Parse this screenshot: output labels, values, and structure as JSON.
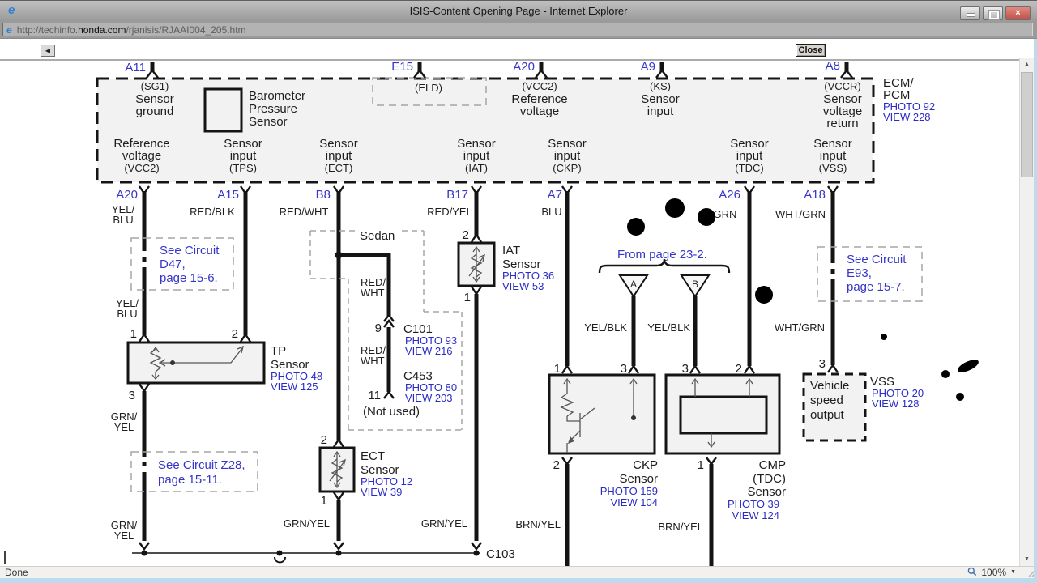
{
  "colors": {
    "link_blue": "#2b2bc6",
    "label_blue": "#3636c8",
    "diagram_black": "#1e1e1e",
    "box_fill": "#f2f2f2",
    "close_button_red": "#c0504a",
    "titlebar_gray": "#a8a8a8",
    "frame_blue": "#badcee"
  },
  "window": {
    "title": "ISIS-Content Opening Page - Internet Explorer"
  },
  "icons": {
    "ie_logo": "e",
    "back": "◀",
    "scroll_up": "▲",
    "scroll_down": "▼",
    "dropdown": "▼",
    "close_window": "×"
  },
  "address": {
    "url_pre": "http://techinfo.",
    "url_domain": "honda.com",
    "url_path": "/rjanisis/RJAAI004_205.htm"
  },
  "toolbar": {
    "close_label": "Close"
  },
  "statusbar": {
    "status": "Done",
    "zoom": "100%"
  },
  "diagram": {
    "ecm": {
      "pin_a11": "A11",
      "pin_e15": "E15",
      "pin_a20": "A20",
      "pin_a9": "A9",
      "pin_a8": "A8",
      "sg1": [
        "(SG1)",
        "Sensor",
        "ground"
      ],
      "baro": [
        "Barometer",
        "Pressure",
        "Sensor"
      ],
      "eld": "(ELD)",
      "vcc2": [
        "(VCC2)",
        "Reference",
        "voltage"
      ],
      "ks": [
        "(KS)",
        "Sensor",
        "input"
      ],
      "vccr": [
        "(VCCR)",
        "Sensor",
        "voltage",
        "return"
      ],
      "name": [
        "ECM/",
        "PCM"
      ],
      "photo": "PHOTO 92",
      "view": "VIEW 228",
      "out_vcc2": [
        "Reference",
        "voltage",
        "(VCC2)"
      ],
      "out_tps": [
        "Sensor",
        "input",
        "(TPS)"
      ],
      "out_ect": [
        "Sensor",
        "input",
        "(ECT)"
      ],
      "out_iat": [
        "Sensor",
        "input",
        "(IAT)"
      ],
      "out_ckp": [
        "Sensor",
        "input",
        "(CKP)"
      ],
      "out_tdc": [
        "Sensor",
        "input",
        "(TDC)"
      ],
      "out_vss": [
        "Sensor",
        "input",
        "(VSS)"
      ]
    },
    "pins": {
      "a20": "A20",
      "a15": "A15",
      "b8": "B8",
      "b17": "B17",
      "a7": "A7",
      "a26": "A26",
      "a18": "A18"
    },
    "wire_colors": {
      "yel_blu": [
        "YEL/",
        "BLU"
      ],
      "red_blk": "RED/BLK",
      "red_wht": "RED/WHT",
      "red_yel": "RED/YEL",
      "blu": "BLU",
      "grn": "GRN",
      "wht_grn": "WHT/GRN",
      "yel_blu_2": [
        "YEL/",
        "BLU"
      ],
      "grn_yel_1": [
        "GRN/",
        "YEL"
      ],
      "grn_yel_2": [
        "GRN/",
        "YEL"
      ],
      "red_wht_sedan_1": [
        "RED/",
        "WHT"
      ],
      "red_wht_sedan_2": [
        "RED/",
        "WHT"
      ],
      "grn_yel_ect": "GRN/YEL",
      "grn_yel_iat": "GRN/YEL",
      "yel_blk_a": "YEL/BLK",
      "yel_blk_b": "YEL/BLK",
      "brn_yel_ckp": "BRN/YEL",
      "brn_yel_cmp": "BRN/YEL",
      "wht_grn_2": "WHT/GRN"
    },
    "refs": {
      "d47": [
        "See Circuit",
        "D47,",
        "page 15-6."
      ],
      "z28": [
        "See Circuit Z28,",
        "page 15-11."
      ],
      "e93": [
        "See Circuit",
        "E93,",
        "page 15-7."
      ],
      "from_page": "From page 23-2."
    },
    "sedan_label": "Sedan",
    "not_used": "(Not used)",
    "tp": {
      "pin1": "1",
      "pin2": "2",
      "pin3": "3",
      "name": [
        "TP",
        "Sensor"
      ],
      "photo": "PHOTO 48",
      "view": "VIEW 125"
    },
    "iat": {
      "pin2": "2",
      "pin1": "1",
      "name": [
        "IAT",
        "Sensor"
      ],
      "photo": "PHOTO 36",
      "view": "VIEW 53"
    },
    "ect": {
      "pin2": "2",
      "pin1": "1",
      "name": [
        "ECT",
        "Sensor"
      ],
      "photo": "PHOTO 12",
      "view": "VIEW 39"
    },
    "c101": {
      "pin": "9",
      "name": "C101",
      "photo": "PHOTO 93",
      "view": "VIEW 216"
    },
    "c453": {
      "pin": "11",
      "name": "C453",
      "photo": "PHOTO 80",
      "view": "VIEW 203"
    },
    "triangles": {
      "a": "A",
      "b": "B"
    },
    "ckp": {
      "pin1": "1",
      "pin3": "3",
      "pin2": "2",
      "name": [
        "CKP",
        "Sensor"
      ],
      "photo": "PHOTO 159",
      "view": "VIEW 104"
    },
    "cmp": {
      "pin3": "3",
      "pin2": "2",
      "pin1": "1",
      "name": [
        "CMP",
        "(TDC)",
        "Sensor"
      ],
      "photo": "PHOTO 39",
      "view": "VIEW 124"
    },
    "vss": {
      "pin3": "3",
      "box": [
        "Vehicle",
        "speed",
        "output"
      ],
      "name": "VSS",
      "photo": "PHOTO 20",
      "view": "VIEW 128"
    },
    "c103": "C103"
  }
}
